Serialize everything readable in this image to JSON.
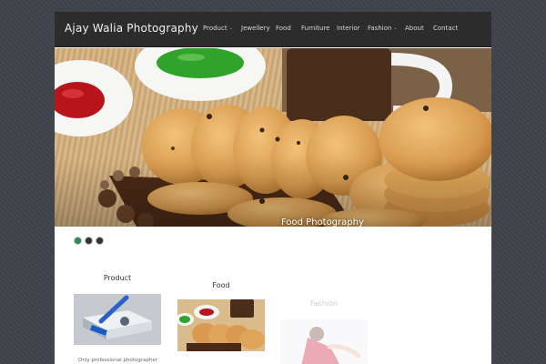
{
  "site": {
    "title": "Ajay Walia Photography"
  },
  "nav": {
    "items": [
      {
        "label": "Product",
        "has_dropdown": true
      },
      {
        "label": "Jewellery",
        "has_dropdown": false
      },
      {
        "label": "Food",
        "has_dropdown": false
      },
      {
        "label": "Furniture",
        "has_dropdown": false
      },
      {
        "label": "Interior",
        "has_dropdown": false
      },
      {
        "label": "Fashion",
        "has_dropdown": true
      },
      {
        "label": "About",
        "has_dropdown": false
      },
      {
        "label": "Contact",
        "has_dropdown": false
      }
    ],
    "dropdown_glyph": "⌄"
  },
  "hero": {
    "caption": "Food Photography",
    "slide_count": 3,
    "active_slide": 1
  },
  "features": [
    {
      "title": "Product",
      "text": "Only professional photographer"
    },
    {
      "title": "Food",
      "text": ""
    },
    {
      "title": "Fashion",
      "text": ""
    }
  ],
  "colors": {
    "page_bg": "#3f434a",
    "header_bg": "#2c2c2c",
    "active_dot": "#2e8b57"
  }
}
